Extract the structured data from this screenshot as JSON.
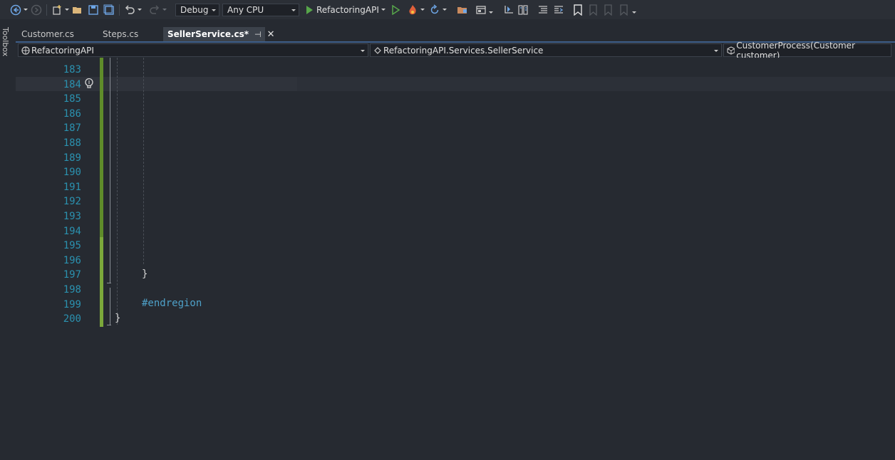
{
  "toolbar": {
    "config": "Debug",
    "platform": "Any CPU",
    "run_target": "RefactoringAPI"
  },
  "toolbox": {
    "label": "Toolbox"
  },
  "tabs": [
    {
      "label": "Customer.cs"
    },
    {
      "label": "Steps.cs"
    },
    {
      "label": "SellerService.cs*",
      "pin": "⊣",
      "close": "✕"
    }
  ],
  "navbar": {
    "project": "RefactoringAPI",
    "type": "RefactoringAPI.Services.SellerService",
    "member": "CustomerProcess(Customer customer)"
  },
  "editor": {
    "line_numbers": [
      "183",
      "184",
      "185",
      "186",
      "187",
      "188",
      "189",
      "190",
      "191",
      "192",
      "193",
      "194",
      "195",
      "196",
      "197",
      "198",
      "199",
      "200"
    ],
    "code": {
      "line197": "}",
      "line199": "#endregion",
      "line200": "}"
    }
  },
  "colors": {
    "background": "#262a31",
    "line_number": "#2b91af",
    "directive": "#4ea1c9",
    "change_bar": "#5f8c2a"
  }
}
